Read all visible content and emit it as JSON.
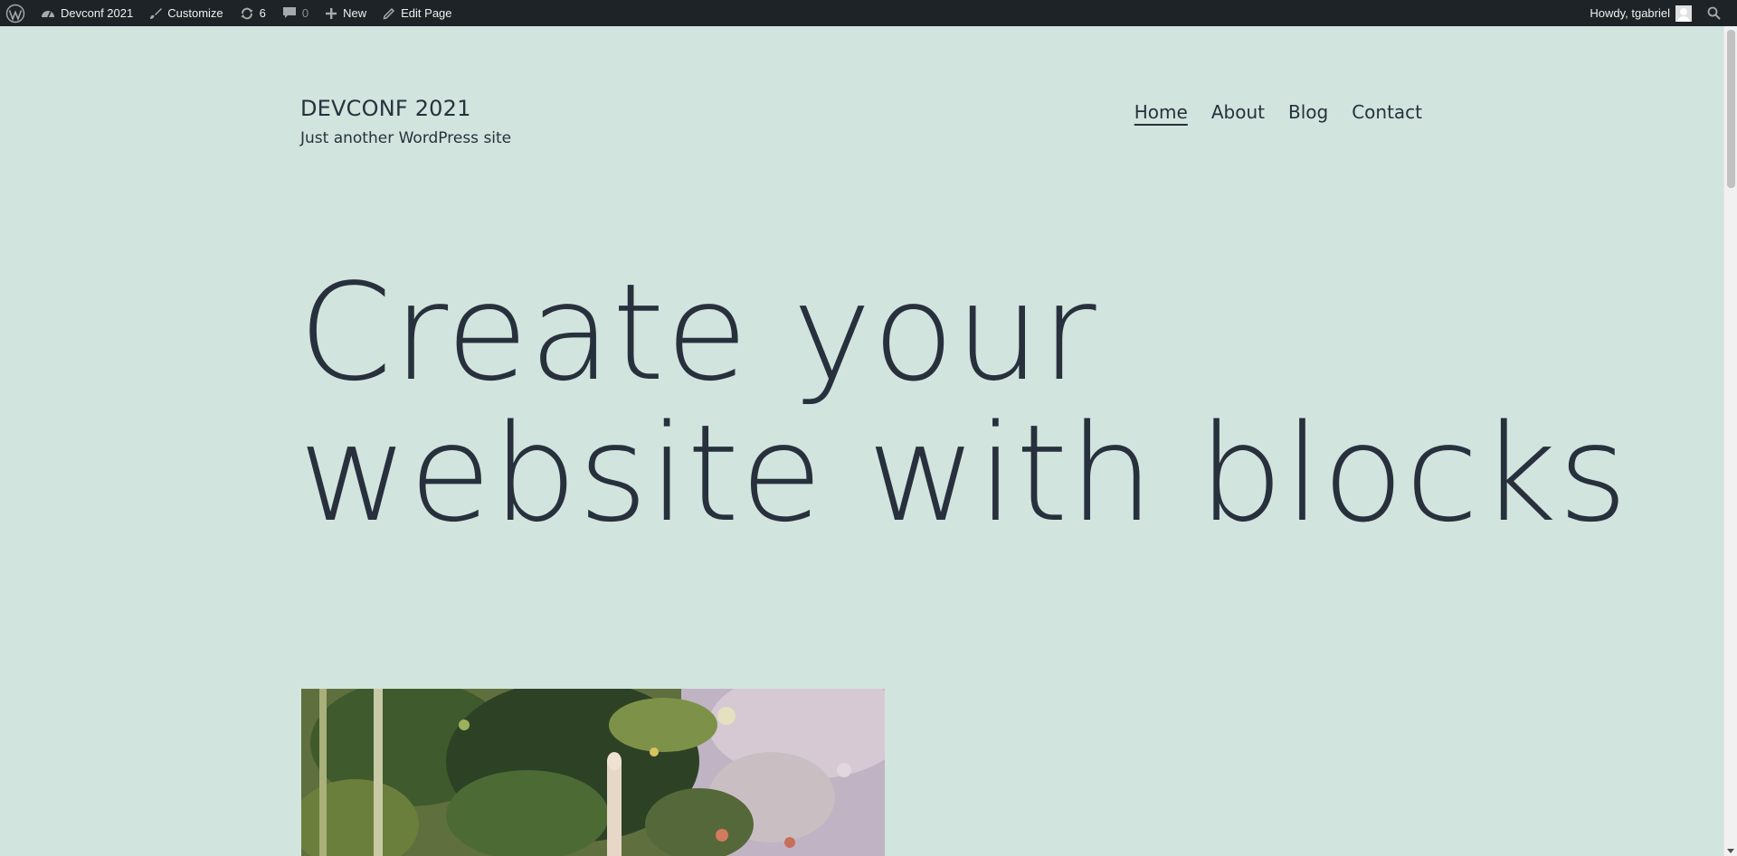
{
  "adminbar": {
    "wp_logo_icon": "wordpress-icon",
    "site_name": "Devconf 2021",
    "customize_label": "Customize",
    "updates_count": "6",
    "comments_count": "0",
    "new_label": "New",
    "edit_label": "Edit Page",
    "howdy_label": "Howdy, tgabriel"
  },
  "header": {
    "site_title": "DEVCONF 2021",
    "site_description": "Just another WordPress site",
    "nav": [
      {
        "label": "Home",
        "current": true
      },
      {
        "label": "About",
        "current": false
      },
      {
        "label": "Blog",
        "current": false
      },
      {
        "label": "Contact",
        "current": false
      }
    ]
  },
  "hero": {
    "line1": "Create your",
    "line2": "website with blocks"
  },
  "colors": {
    "background": "#d1e4dd",
    "text": "#28303d",
    "adminbar": "#1d2327"
  }
}
